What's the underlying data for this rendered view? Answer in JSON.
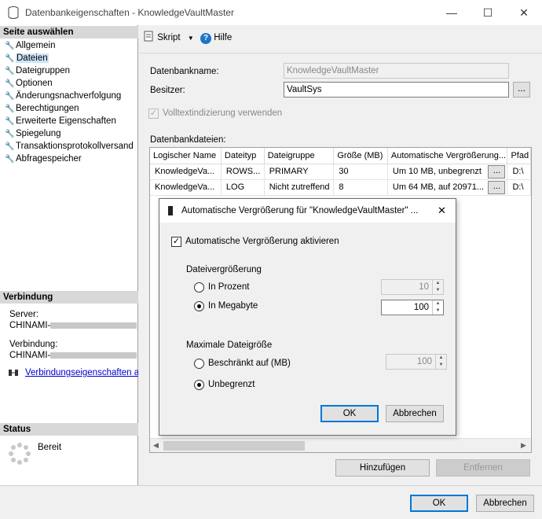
{
  "window": {
    "title": "Datenbankeigenschaften - KnowledgeVaultMaster",
    "minimize": "—",
    "maximize": "☐",
    "close": "✕"
  },
  "left": {
    "select_page_header": "Seite auswählen",
    "pages": [
      {
        "label": "Allgemein"
      },
      {
        "label": "Dateien"
      },
      {
        "label": "Dateigruppen"
      },
      {
        "label": "Optionen"
      },
      {
        "label": "Änderungsnachverfolgung"
      },
      {
        "label": "Berechtigungen"
      },
      {
        "label": "Erweiterte Eigenschaften"
      },
      {
        "label": "Spiegelung"
      },
      {
        "label": "Transaktionsprotokollversand"
      },
      {
        "label": "Abfragespeicher"
      }
    ],
    "selected_page": "Dateien",
    "connection_header": "Verbindung",
    "server_label": "Server:",
    "server_value": "CHINAMI-",
    "connection_label": "Verbindung:",
    "connection_value": "CHINAMI-",
    "connection_props_link": "Verbindungseigenschaften anz",
    "status_header": "Status",
    "status_value": "Bereit"
  },
  "toolbar": {
    "script_label": "Skript",
    "help_label": "Hilfe"
  },
  "form": {
    "dbname_label": "Datenbankname:",
    "dbname_value": "KnowledgeVaultMaster",
    "owner_label": "Besitzer:",
    "owner_value": "VaultSys",
    "browse_label": "...",
    "fulltext_label": "Volltextindizierung verwenden",
    "dbfiles_label": "Datenbankdateien:"
  },
  "files_table": {
    "columns": [
      "Logischer Name",
      "Dateityp",
      "Dateigruppe",
      "Größe (MB)",
      "Automatische Vergrößerung...",
      "Pfad"
    ],
    "rows": [
      [
        "KnowledgeVa...",
        "ROWS...",
        "PRIMARY",
        "30",
        "Um 10 MB, unbegrenzt",
        "D:\\"
      ],
      [
        "KnowledgeVa...",
        "LOG",
        "Nicht zutreffend",
        "8",
        "Um 64 MB, auf 20971...",
        "D:\\"
      ]
    ]
  },
  "buttons": {
    "add": "Hinzufügen",
    "remove": "Entfernen",
    "ok": "OK",
    "cancel": "Abbrechen"
  },
  "autogrow_dialog": {
    "title": "Automatische Vergrößerung für \"KnowledgeVaultMaster\" ...",
    "close": "✕",
    "enable_label": "Automatische Vergrößerung aktivieren",
    "enable_checked": true,
    "growth_header": "Dateivergrößerung",
    "percent_label": "In Prozent",
    "percent_value": "10",
    "megabyte_label": "In Megabyte",
    "megabyte_value": "100",
    "growth_selected": "In Megabyte",
    "max_header": "Maximale Dateigröße",
    "limited_label": "Beschränkt auf (MB)",
    "limited_value": "100",
    "unlimited_label": "Unbegrenzt",
    "max_selected": "Unbegrenzt",
    "ok": "OK",
    "cancel": "Abbrechen"
  }
}
